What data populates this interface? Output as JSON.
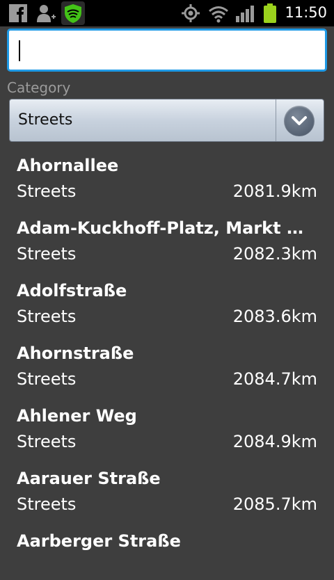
{
  "status_bar": {
    "icons_left": [
      "facebook-icon",
      "add-contact-icon",
      "security-shield-icon"
    ],
    "icons_right": [
      "gps-icon",
      "wifi-icon",
      "signal-icon",
      "battery-icon"
    ],
    "time": "11:50"
  },
  "search": {
    "value": "",
    "placeholder": ""
  },
  "category": {
    "label": "Category",
    "selected": "Streets"
  },
  "results": [
    {
      "name": "Ahornallee",
      "category": "Streets",
      "distance": "2081.9km"
    },
    {
      "name": "Adam-Kuckhoff-Platz, Markt Mi...",
      "category": "Streets",
      "distance": "2082.3km"
    },
    {
      "name": "Adolfstraße",
      "category": "Streets",
      "distance": "2083.6km"
    },
    {
      "name": "Ahornstraße",
      "category": "Streets",
      "distance": "2084.7km"
    },
    {
      "name": "Ahlener Weg",
      "category": "Streets",
      "distance": "2084.9km"
    },
    {
      "name": "Aarauer Straße",
      "category": "Streets",
      "distance": "2085.7km"
    },
    {
      "name": "Aarberger Straße",
      "category": "",
      "distance": ""
    }
  ],
  "colors": {
    "accent": "#1e9ae6",
    "background": "#3e3e3e",
    "battery": "#9bd21d",
    "shield": "#43c317"
  }
}
